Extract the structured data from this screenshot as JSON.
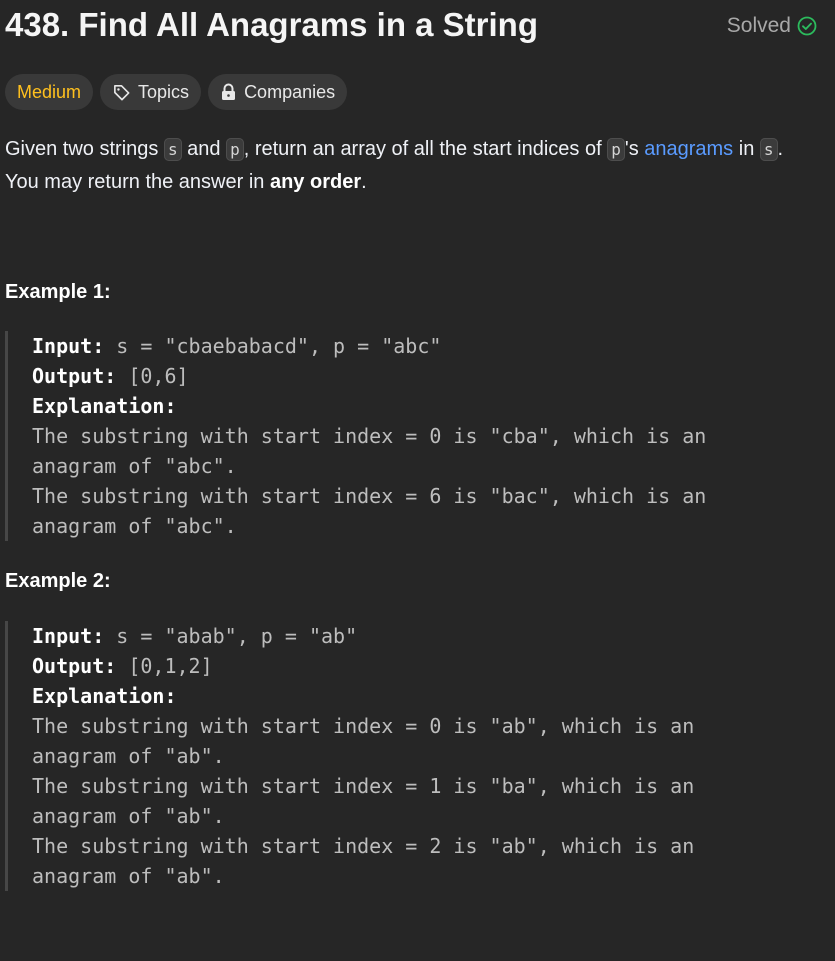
{
  "problem": {
    "title": "438. Find All Anagrams in a String",
    "status": "Solved"
  },
  "tags": {
    "difficulty": "Medium",
    "topics": "Topics",
    "companies": "Companies"
  },
  "description": {
    "t1": "Given two strings ",
    "c1": "s",
    "t2": " and ",
    "c2": "p",
    "t3": ", return an array of all the start indices of ",
    "c3": "p",
    "t4": "'s ",
    "link": "anagrams",
    "t5": " in ",
    "c4": "s",
    "t6": ". You may return the answer in ",
    "bold": "any order",
    "t7": "."
  },
  "examples": [
    {
      "title": "Example 1:",
      "input_label": "Input:",
      "input_value": " s = \"cbaebabacd\", p = \"abc\"",
      "output_label": "Output:",
      "output_value": " [0,6]",
      "explanation_label": "Explanation:",
      "lines": [
        "The substring with start index = 0 is \"cba\", which is an",
        "anagram of \"abc\".",
        "The substring with start index = 6 is \"bac\", which is an",
        "anagram of \"abc\"."
      ]
    },
    {
      "title": "Example 2:",
      "input_label": "Input:",
      "input_value": " s = \"abab\", p = \"ab\"",
      "output_label": "Output:",
      "output_value": " [0,1,2]",
      "explanation_label": "Explanation:",
      "lines": [
        "The substring with start index = 0 is \"ab\", which is an",
        "anagram of \"ab\".",
        "The substring with start index = 1 is \"ba\", which is an",
        "anagram of \"ab\".",
        "The substring with start index = 2 is \"ab\", which is an",
        "anagram of \"ab\"."
      ]
    }
  ],
  "colors": {
    "background": "#262626",
    "difficulty_medium": "#ffc01e",
    "link": "#5a9bff",
    "solved_check": "#2cbb5d"
  },
  "icons": {
    "solved": "check-circle-icon",
    "topics": "tag-icon",
    "companies": "lock-icon"
  }
}
